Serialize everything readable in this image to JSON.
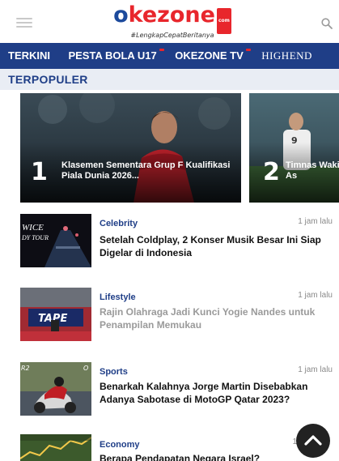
{
  "header": {
    "menu_icon": "hamburger-menu-icon",
    "logo_text_o": "o",
    "logo_text_ke": "ke",
    "logo_text_zone": "zone",
    "logo_badge": "com",
    "tagline": "#LengkapCepatBeritanya",
    "search_icon": "search-icon"
  },
  "nav": {
    "items": [
      {
        "label": "TERKINI",
        "hot": false
      },
      {
        "label": "PESTA BOLA U17",
        "hot": true
      },
      {
        "label": "OKEZONE TV",
        "hot": true
      },
      {
        "label": "HIGHEND",
        "hot": false
      }
    ]
  },
  "section": {
    "title": "TERPOPULER"
  },
  "carousel": [
    {
      "rank": "1",
      "title": "Klasemen Sementara Grup F Kualifikasi Piala Dunia 2026..."
    },
    {
      "rank": "2",
      "title": "Timnas Wakil As"
    }
  ],
  "articles": [
    {
      "category": "Celebrity",
      "time": "1 jam lalu",
      "title": "Setelah Coldplay, 2 Konser Musik Besar Ini Siap Digelar di Indonesia",
      "thumb_text": "WICE\nDY TOUR"
    },
    {
      "category": "Lifestyle",
      "time": "1 jam lalu",
      "title": "Rajin Olahraga Jadi Kunci Yogie Nandes untuk Penampilan Memukau",
      "thumb_text": "TAPE"
    },
    {
      "category": "Sports",
      "time": "1 jam lalu",
      "title": "Benarkah Kalahnya Jorge Martin Disebabkan Adanya Sabotase di MotoGP Qatar 2023?"
    },
    {
      "category": "Economy",
      "time": "1",
      "title": "Berapa Pendapatan Negara Israel?"
    }
  ],
  "colors": {
    "brand_blue": "#1f3e87",
    "brand_red": "#e8262c",
    "section_bg": "#e9edf4"
  },
  "scroll_top_icon": "chevron-up-icon"
}
